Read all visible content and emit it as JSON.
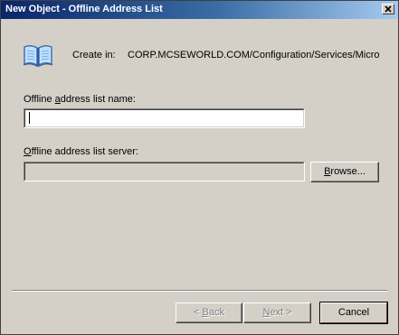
{
  "window": {
    "title": "New Object - Offline Address List"
  },
  "icons": {
    "book": "open-book-icon",
    "close": "close-icon"
  },
  "create_in": {
    "label": "Create in:",
    "value": "CORP.MCSEWORLD.COM/Configuration/Services/Micro"
  },
  "name_field": {
    "label_pre": "Offline ",
    "label_accel": "a",
    "label_post": "ddress list name:",
    "value": ""
  },
  "server_field": {
    "label_pre": "",
    "label_accel": "O",
    "label_post": "ffline address list server:",
    "value": ""
  },
  "buttons": {
    "browse_pre": "",
    "browse_accel": "B",
    "browse_post": "rowse...",
    "back_pre": "< ",
    "back_accel": "B",
    "back_post": "ack",
    "next_accel": "N",
    "next_post": "ext >",
    "cancel": "Cancel"
  },
  "colors": {
    "title_gradient_start": "#0a246a",
    "title_gradient_end": "#a6caf0",
    "dialog_face": "#d4d0c8"
  }
}
